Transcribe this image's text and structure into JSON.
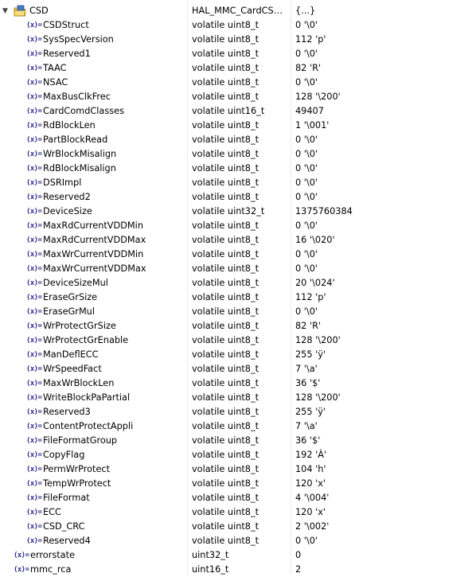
{
  "colors": {
    "background": "#ffffff",
    "separator": "#ececec",
    "var_icon": "#2c2c8c"
  },
  "icons": {
    "expanded": "chevron-down-icon",
    "struct": "struct-folder-icon",
    "variable": "variable-icon"
  },
  "root": {
    "name": "CSD",
    "type": "HAL_MMC_CardCSD...",
    "value": "{...}",
    "var_icon": "(x)="
  },
  "fields": [
    {
      "name": "CSDStruct",
      "type": "volatile uint8_t",
      "value": "0 '\\0'"
    },
    {
      "name": "SysSpecVersion",
      "type": "volatile uint8_t",
      "value": "112 'p'"
    },
    {
      "name": "Reserved1",
      "type": "volatile uint8_t",
      "value": "0 '\\0'"
    },
    {
      "name": "TAAC",
      "type": "volatile uint8_t",
      "value": "82 'R'"
    },
    {
      "name": "NSAC",
      "type": "volatile uint8_t",
      "value": "0 '\\0'"
    },
    {
      "name": "MaxBusClkFrec",
      "type": "volatile uint8_t",
      "value": "128 '\\200'"
    },
    {
      "name": "CardComdClasses",
      "type": "volatile uint16_t",
      "value": "49407"
    },
    {
      "name": "RdBlockLen",
      "type": "volatile uint8_t",
      "value": "1 '\\001'"
    },
    {
      "name": "PartBlockRead",
      "type": "volatile uint8_t",
      "value": "0 '\\0'"
    },
    {
      "name": "WrBlockMisalign",
      "type": "volatile uint8_t",
      "value": "0 '\\0'"
    },
    {
      "name": "RdBlockMisalign",
      "type": "volatile uint8_t",
      "value": "0 '\\0'"
    },
    {
      "name": "DSRImpl",
      "type": "volatile uint8_t",
      "value": "0 '\\0'"
    },
    {
      "name": "Reserved2",
      "type": "volatile uint8_t",
      "value": "0 '\\0'"
    },
    {
      "name": "DeviceSize",
      "type": "volatile uint32_t",
      "value": "1375760384"
    },
    {
      "name": "MaxRdCurrentVDDMin",
      "type": "volatile uint8_t",
      "value": "0 '\\0'"
    },
    {
      "name": "MaxRdCurrentVDDMax",
      "type": "volatile uint8_t",
      "value": "16 '\\020'"
    },
    {
      "name": "MaxWrCurrentVDDMin",
      "type": "volatile uint8_t",
      "value": "0 '\\0'"
    },
    {
      "name": "MaxWrCurrentVDDMax",
      "type": "volatile uint8_t",
      "value": "0 '\\0'"
    },
    {
      "name": "DeviceSizeMul",
      "type": "volatile uint8_t",
      "value": "20 '\\024'"
    },
    {
      "name": "EraseGrSize",
      "type": "volatile uint8_t",
      "value": "112 'p'"
    },
    {
      "name": "EraseGrMul",
      "type": "volatile uint8_t",
      "value": "0 '\\0'"
    },
    {
      "name": "WrProtectGrSize",
      "type": "volatile uint8_t",
      "value": "82 'R'"
    },
    {
      "name": "WrProtectGrEnable",
      "type": "volatile uint8_t",
      "value": "128 '\\200'"
    },
    {
      "name": "ManDeflECC",
      "type": "volatile uint8_t",
      "value": "255 'ÿ'"
    },
    {
      "name": "WrSpeedFact",
      "type": "volatile uint8_t",
      "value": "7 '\\a'"
    },
    {
      "name": "MaxWrBlockLen",
      "type": "volatile uint8_t",
      "value": "36 '$'"
    },
    {
      "name": "WriteBlockPaPartial",
      "type": "volatile uint8_t",
      "value": "128 '\\200'"
    },
    {
      "name": "Reserved3",
      "type": "volatile uint8_t",
      "value": "255 'ÿ'"
    },
    {
      "name": "ContentProtectAppli",
      "type": "volatile uint8_t",
      "value": "7 '\\a'"
    },
    {
      "name": "FileFormatGroup",
      "type": "volatile uint8_t",
      "value": "36 '$'"
    },
    {
      "name": "CopyFlag",
      "type": "volatile uint8_t",
      "value": "192 'À'"
    },
    {
      "name": "PermWrProtect",
      "type": "volatile uint8_t",
      "value": "104 'h'"
    },
    {
      "name": "TempWrProtect",
      "type": "volatile uint8_t",
      "value": "120 'x'"
    },
    {
      "name": "FileFormat",
      "type": "volatile uint8_t",
      "value": "4 '\\004'"
    },
    {
      "name": "ECC",
      "type": "volatile uint8_t",
      "value": "120 'x'"
    },
    {
      "name": "CSD_CRC",
      "type": "volatile uint8_t",
      "value": "2 '\\002'"
    },
    {
      "name": "Reserved4",
      "type": "volatile uint8_t",
      "value": "0 '\\0'"
    }
  ],
  "siblings": [
    {
      "name": "errorstate",
      "type": "uint32_t",
      "value": "0"
    },
    {
      "name": "mmc_rca",
      "type": "uint16_t",
      "value": "2"
    }
  ]
}
